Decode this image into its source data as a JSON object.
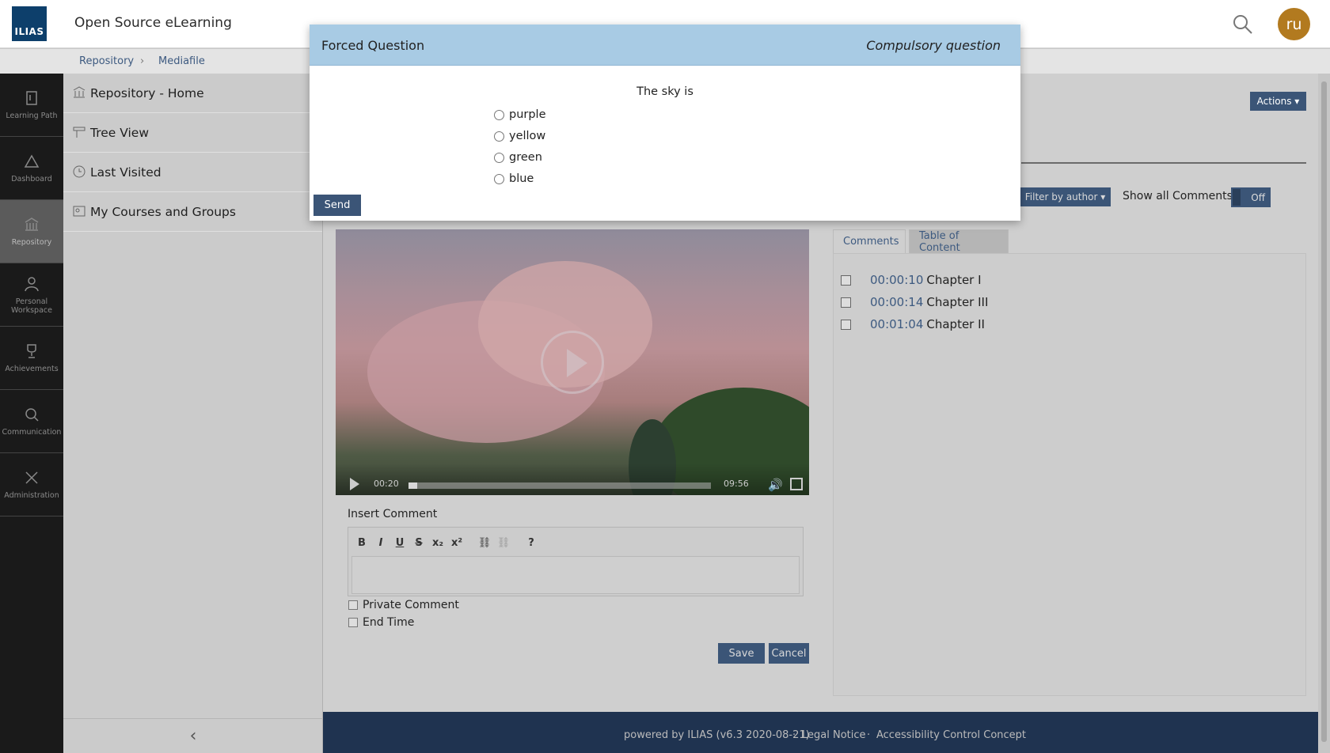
{
  "header": {
    "logo_text": "ILIAS",
    "title": "Open Source eLearning",
    "avatar_initials": "ru"
  },
  "breadcrumb": {
    "items": [
      "Repository",
      "Mediafile"
    ]
  },
  "mainbar": {
    "items": [
      {
        "label": "Learning Path",
        "icon": "learning-path-icon"
      },
      {
        "label": "Dashboard",
        "icon": "dashboard-icon"
      },
      {
        "label": "Repository",
        "icon": "repository-icon"
      },
      {
        "label_line1": "Personal",
        "label_line2": "Workspace",
        "icon": "person-icon"
      },
      {
        "label": "Achievements",
        "icon": "trophy-icon"
      },
      {
        "label": "Communication",
        "icon": "chat-icon"
      },
      {
        "label": "Administration",
        "icon": "tools-icon"
      }
    ]
  },
  "slate": {
    "items": [
      {
        "label": "Repository - Home",
        "icon": "repository-icon"
      },
      {
        "label": "Tree View",
        "icon": "tree-icon",
        "chevron": "›"
      },
      {
        "label": "Last Visited",
        "icon": "clock-icon",
        "chevron": "›"
      },
      {
        "label": "My Courses and Groups",
        "icon": "courses-icon"
      }
    ],
    "collapse_glyph": "‹"
  },
  "toolbar": {
    "actions_label": "Actions ▾",
    "filter_label": "Filter by author ▾",
    "show_all_label": "Show all Comments:",
    "toggle_label": "Off"
  },
  "video": {
    "current_time": "00:20",
    "duration": "09:56",
    "progress": 0.03
  },
  "comment_form": {
    "label": "Insert Comment",
    "toolbar": [
      "B",
      "I",
      "U",
      "S",
      "x₂",
      "x²",
      "⛓",
      "⛓",
      "?"
    ],
    "private_label": "Private Comment",
    "end_time_label": "End Time",
    "save_label": "Save",
    "cancel_label": "Cancel"
  },
  "tabs": [
    {
      "label": "Comments"
    },
    {
      "label": "Table of Content"
    }
  ],
  "toc": [
    {
      "time": "00:00:10",
      "title": "Chapter I"
    },
    {
      "time": "00:00:14",
      "title": "Chapter III"
    },
    {
      "time": "00:01:04",
      "title": "Chapter II"
    }
  ],
  "footer": {
    "powered": "powered by ILIAS (v6.3 2020-08-21)",
    "sep": "·",
    "legal": "Legal Notice",
    "accessibility": "Accessibility Control Concept"
  },
  "modal": {
    "title": "Forced Question",
    "subtitle": "Compulsory question",
    "question": "The sky is",
    "options": [
      "purple",
      "yellow",
      "green",
      "blue"
    ],
    "send_label": "Send"
  },
  "colors": {
    "accent": "#3b5577",
    "modal_header": "#a8cbe4",
    "avatar": "#b27a1f",
    "footer": "#1f3350"
  }
}
